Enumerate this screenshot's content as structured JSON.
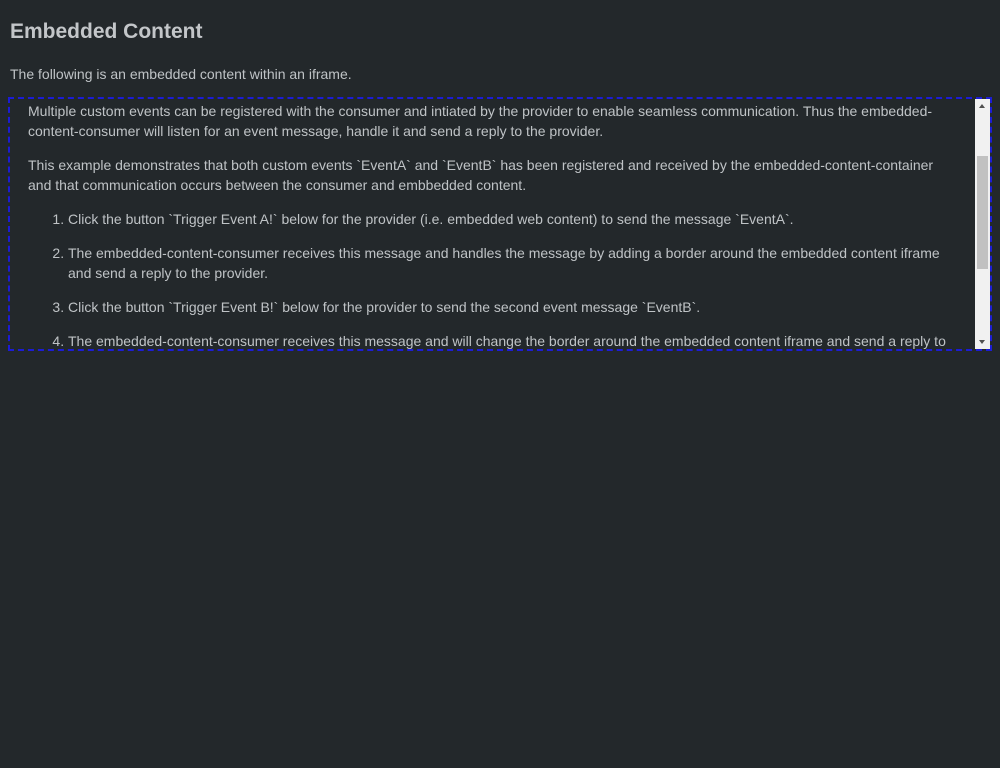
{
  "page": {
    "title": "Embedded Content",
    "intro": "The following is an embedded content within an iframe."
  },
  "iframe": {
    "paragraphs": [
      "Multiple custom events can be registered with the consumer and intiated by the provider to enable seamless communication. Thus the embedded-content-consumer will listen for an event message, handle it and send a reply to the provider.",
      "This example demonstrates that both custom events `EventA` and `EventB` has been registered and received by the embedded-content-container and that communication occurs between the consumer and embbedded content."
    ],
    "steps": [
      "Click the button `Trigger Event A!` below for the provider (i.e. embedded web content) to send the message `EventA`.",
      "The embedded-content-consumer receives this message and handles the message by adding a border around the embedded content iframe and send a reply to the provider.",
      "Click the button `Trigger Event B!` below for the provider to send the second event message `EventB`.",
      "The embedded-content-consumer receives this message and will change the border around the embedded content iframe and send a reply to"
    ],
    "border_color": "#1c1cd6"
  },
  "scrollbar": {
    "up_icon": "arrow-up-icon",
    "down_icon": "arrow-down-icon"
  }
}
